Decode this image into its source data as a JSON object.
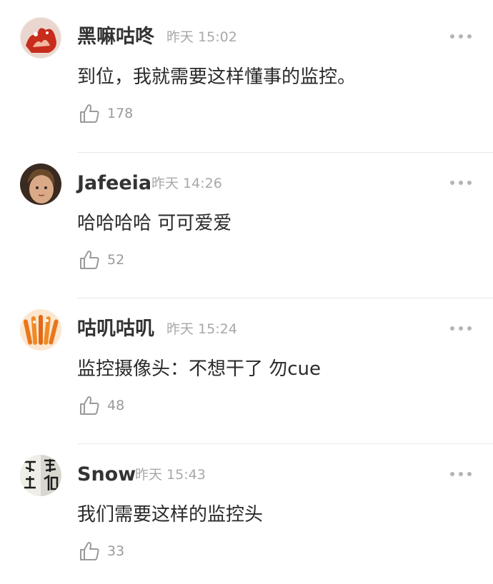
{
  "comments": [
    {
      "username": "黑嘛咕咚",
      "time": "昨天 15:02",
      "text": "到位，我就需要这样懂事的监控。",
      "likes": "178",
      "avatar": "red-fire-avatar"
    },
    {
      "username": "Jafeeia",
      "time": "昨天 14:26",
      "text": "哈哈哈哈 可可爱爱",
      "likes": "52",
      "avatar": "child-photo-avatar"
    },
    {
      "username": "咕叽咕叽",
      "time": "昨天 15:24",
      "text": "监控摄像头：不想干了 勿cue",
      "likes": "48",
      "avatar": "orange-fries-avatar"
    },
    {
      "username": "Snow",
      "time": "昨天 15:43",
      "text": "我们需要这样的监控头",
      "likes": "33",
      "avatar": "calligraphy-avatar"
    }
  ],
  "icons": {
    "like": "thumbs-up-icon",
    "more": "more-dots-icon"
  },
  "colors": {
    "username": "#333333",
    "timestamp": "#a8a8a8",
    "body_text": "#2a2a2a",
    "count": "#9a9a9a",
    "divider": "#e8e8e8"
  }
}
